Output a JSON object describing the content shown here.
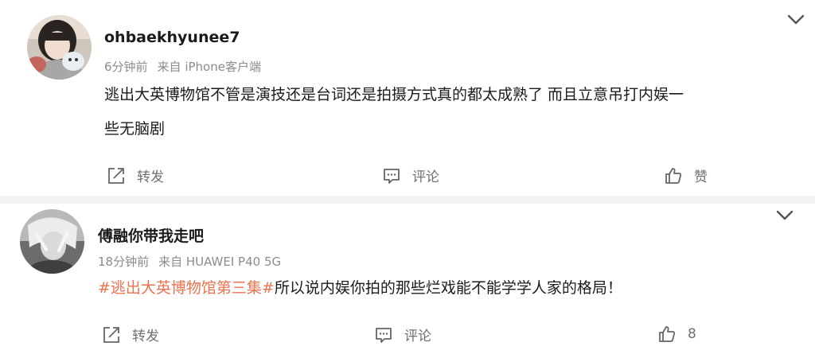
{
  "posts": [
    {
      "username": "ohbaekhyunee7",
      "time": "6分钟前",
      "source": "来自 iPhone客户端",
      "content_line1": "逃出大英博物馆不管是演技还是台词还是拍摄方式真的都太成熟了 而且立意吊打内娱一",
      "content_line2": "些无脑剧",
      "actions": {
        "forward": "转发",
        "comment": "评论",
        "like": "赞"
      }
    },
    {
      "username": "傅融你带我走吧",
      "time": "18分钟前",
      "source": "来自 HUAWEI P40 5G",
      "hashtag": "#逃出大英博物馆第三集#",
      "content_rest": "所以说内娱你拍的那些烂戏能不能学学人家的格局！",
      "actions": {
        "forward": "转发",
        "comment": "评论",
        "like": "8"
      }
    }
  ],
  "colors": {
    "hashtag": "#eb7350",
    "meta": "#8c8c8c",
    "divider": "#f2f2f2"
  },
  "icons": [
    "chevron-down-icon",
    "forward-icon",
    "comment-icon",
    "like-icon"
  ]
}
